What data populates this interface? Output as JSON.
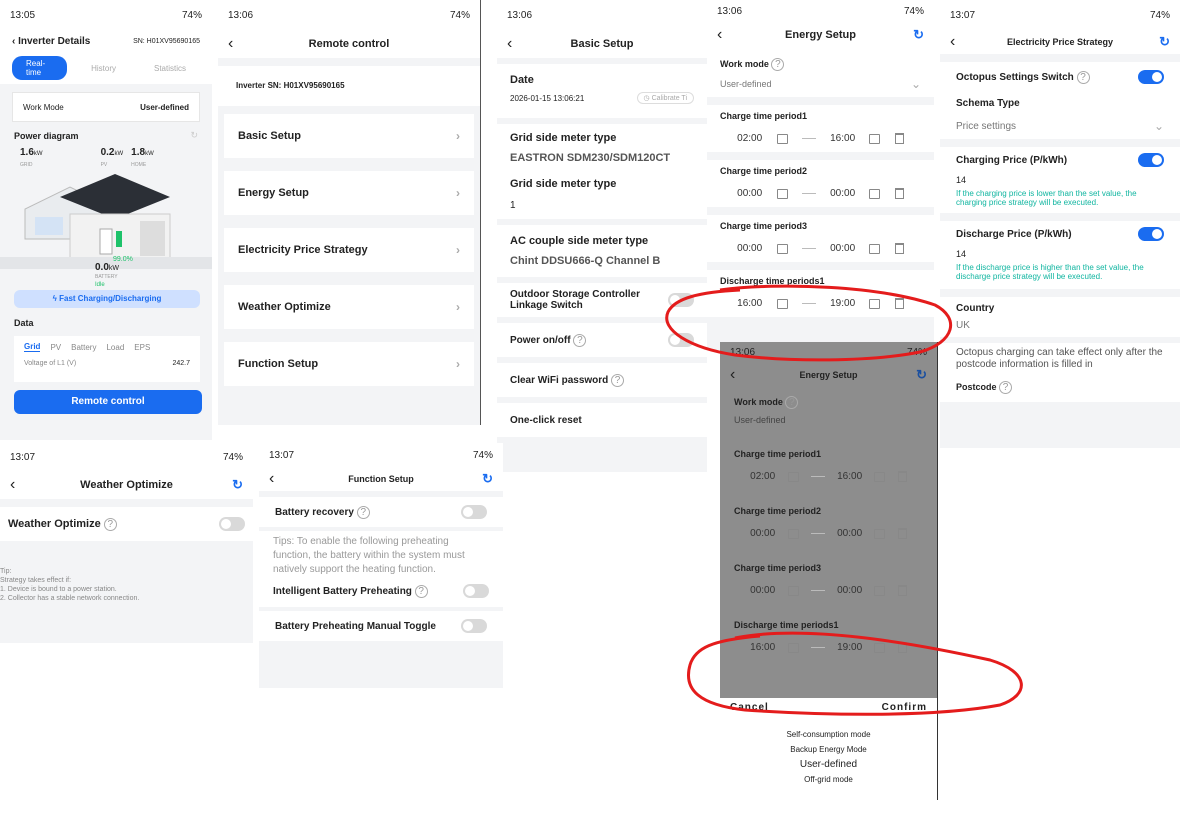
{
  "p1": {
    "time": "13:05",
    "status": "74%",
    "title": "Inverter Details",
    "sn": "SN: H01XV95690165",
    "tabs": [
      "Real-time",
      "History",
      "Statistics"
    ],
    "work_mode_label": "Work Mode",
    "work_mode_value": "User-defined",
    "power_diagram": "Power diagram",
    "grid_val": "1.6",
    "grid_unit": "kW",
    "grid_lbl": "GRID",
    "pv_val": "0.2",
    "pv_unit": "kW",
    "pv_lbl": "PV",
    "home_val": "1.8",
    "home_unit": "kW",
    "home_lbl": "HOME",
    "bat_pct": "99.0%",
    "bat_val": "0.0",
    "bat_unit": "kW",
    "bat_lbl": "BATTERY",
    "bat_state": "Idle",
    "fast": "Fast Charging/Discharging",
    "data": "Data",
    "data_tabs": [
      "Grid",
      "PV",
      "Battery",
      "Load",
      "EPS"
    ],
    "voltage_lbl": "Voltage of L1 (V)",
    "voltage_val": "242.7",
    "remote": "Remote control"
  },
  "p2": {
    "time": "13:06",
    "status": "74%",
    "title": "Remote control",
    "sn": "Inverter SN: H01XV95690165",
    "items": [
      "Basic Setup",
      "Energy Setup",
      "Electricity Price Strategy",
      "Weather Optimize",
      "Function Setup"
    ]
  },
  "p3": {
    "time": "13:06",
    "title": "Basic Setup",
    "date_lbl": "Date",
    "date_val": "2026-01-15 13:06:21",
    "calibrate": "Calibrate Ti",
    "grid_meter_lbl": "Grid side meter type",
    "grid_meter_val": "EASTRON SDM230/SDM120CT",
    "grid_meter_lbl2": "Grid side meter type",
    "grid_meter_val2": "1",
    "ac_lbl": "AC couple side meter type",
    "ac_val": "Chint DDSU666-Q Channel B",
    "outdoor": "Outdoor Storage Controller Linkage Switch",
    "power": "Power on/off",
    "wifi": "Clear WiFi password",
    "reset": "One-click reset"
  },
  "p4": {
    "time": "13:06",
    "status": "74%",
    "title": "Energy Setup",
    "work_mode": "Work mode",
    "work_mode_val": "User-defined",
    "periods": [
      {
        "label": "Charge time period1",
        "start": "02:00",
        "end": "16:00"
      },
      {
        "label": "Charge time period2",
        "start": "00:00",
        "end": "00:00"
      },
      {
        "label": "Charge time period3",
        "start": "00:00",
        "end": "00:00"
      },
      {
        "label": "Discharge time periods1",
        "start": "16:00",
        "end": "19:00"
      }
    ]
  },
  "p5": {
    "time": "13:07",
    "status": "74%",
    "title": "Electricity Price Strategy",
    "octopus": "Octopus Settings Switch",
    "schema_lbl": "Schema Type",
    "schema_val": "Price settings",
    "charge_lbl": "Charging Price (P/kWh)",
    "charge_val": "14",
    "charge_note": "If the charging price is lower than the set value, the charging price strategy will be executed.",
    "discharge_lbl": "Discharge Price (P/kWh)",
    "discharge_val": "14",
    "discharge_note": "If the discharge price is higher than the set value, the discharge price strategy will be executed.",
    "country_lbl": "Country",
    "country_val": "UK",
    "octo_note": "Octopus charging can take effect only after the postcode information is filled in",
    "postcode": "Postcode"
  },
  "p6": {
    "time": "13:07",
    "status": "74%",
    "title": "Weather Optimize",
    "label": "Weather Optimize",
    "tip": "Tip:",
    "tip1": "Strategy takes effect if:",
    "tip2": "1. Device is bound to a power station.",
    "tip3": "2. Collector has a stable network connection."
  },
  "p7": {
    "time": "13:07",
    "status": "74%",
    "title": "Function Setup",
    "battery_recovery": "Battery recovery",
    "tips": "Tips: To enable the following preheating function, the battery within the system must natively support the heating function.",
    "preheat": "Intelligent Battery Preheating",
    "manual": "Battery Preheating Manual Toggle"
  },
  "p8": {
    "time": "13:06",
    "status": "74%",
    "title": "Energy Setup",
    "work_mode": "Work mode",
    "work_mode_val": "User-defined",
    "periods": [
      {
        "label": "Charge time period1",
        "start": "02:00",
        "end": "16:00"
      },
      {
        "label": "Charge time period2",
        "start": "00:00",
        "end": "00:00"
      },
      {
        "label": "Charge time period3",
        "start": "00:00",
        "end": "00:00"
      },
      {
        "label": "Discharge time periods1",
        "start": "16:00",
        "end": "19:00"
      }
    ],
    "cancel": "Cancel",
    "confirm": "Confirm",
    "options": [
      "Self-consumption mode",
      "Backup Energy Mode",
      "User-defined",
      "Off-grid mode"
    ]
  }
}
